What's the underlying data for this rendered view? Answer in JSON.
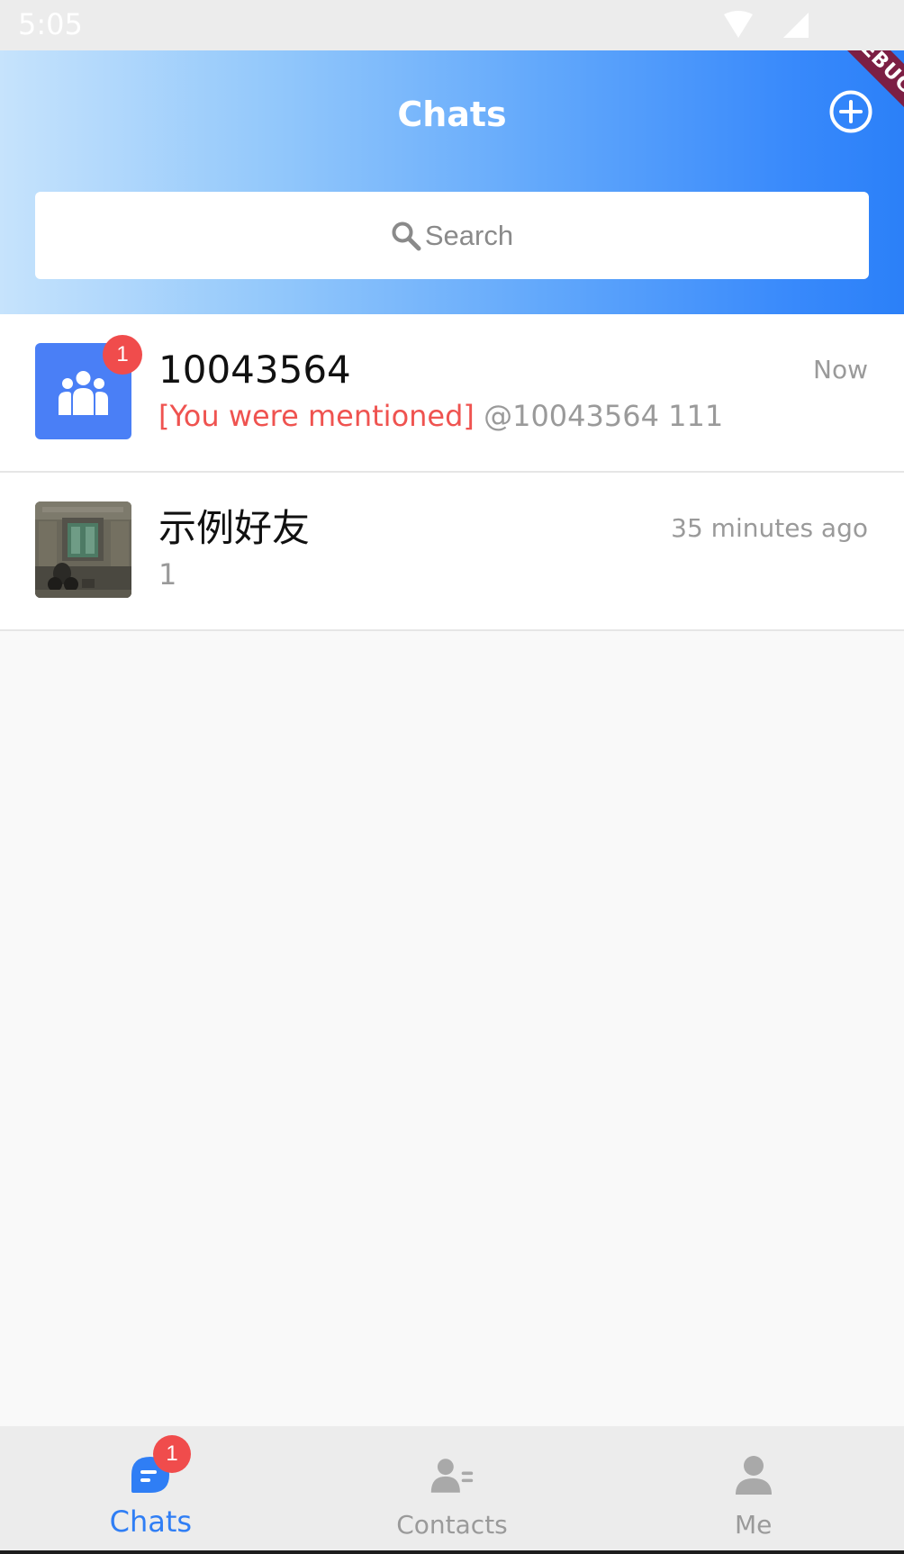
{
  "status_bar": {
    "time": "5:05",
    "icons": [
      "wifi-icon",
      "cellular-icon"
    ]
  },
  "header": {
    "title": "Chats",
    "add_icon": "plus-circle-icon",
    "debug_banner": "DEBUG",
    "search": {
      "icon": "search-icon",
      "placeholder": "Search"
    }
  },
  "conversations": [
    {
      "name": "10043564",
      "avatar": "group-icon",
      "unread": "1",
      "time": "Now",
      "mention_tag": "[You were mentioned]",
      "preview": "@10043564 111"
    },
    {
      "name": "示例好友",
      "avatar": "photo-avatar",
      "time": "35 minutes ago",
      "preview": "1"
    }
  ],
  "tabs": [
    {
      "label": "Chats",
      "icon": "chat-bubble-icon",
      "active": true,
      "badge": "1"
    },
    {
      "label": "Contacts",
      "icon": "contacts-icon",
      "active": false
    },
    {
      "label": "Me",
      "icon": "person-icon",
      "active": false
    }
  ],
  "colors": {
    "accent": "#2f7ef5",
    "badge": "#f04c4c",
    "mention": "#ef5350",
    "header_gradient_start": "#c6e3fc",
    "header_gradient_end": "#2b80f8"
  }
}
